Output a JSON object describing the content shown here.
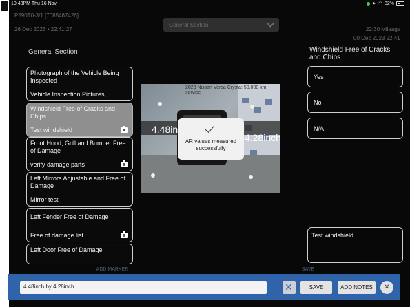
{
  "status_bar": {
    "time": "10:43PM",
    "date": "Thu 16 Nov",
    "battery": "32%"
  },
  "header": {
    "line1": "P590T0-3/1 [7085467426]",
    "line2": "26 Dec 2023 • 22:41:27",
    "section_dropdown": "General Section",
    "right_line1": "22:30 Mileage",
    "right_line2": "00 Dec 2023 22:41"
  },
  "checklist": {
    "title": "General Section",
    "items": [
      {
        "title": "Photograph of the Vehicle Being Inspected",
        "note": "Vehicle Inspection Pictures,"
      },
      {
        "title": "Windshield Free of Cracks and Chips",
        "note": "Test windshield"
      },
      {
        "title": "Front Hood, Grill and Bumper Free of Damage",
        "note": "verify damage parts"
      },
      {
        "title": "Left Mirrors Adjustable and Free of Damage",
        "note": "Mirror test"
      },
      {
        "title": "Left Fender Free of Damage",
        "note": "Free of damage list"
      },
      {
        "title": "Left Door Free of Damage",
        "note": ""
      }
    ]
  },
  "photo": {
    "caption": "2023 Nissan Versa Crysta: 50,000 km service",
    "measure_left": "4.48inch",
    "measure_right": "4.28inch"
  },
  "toast": {
    "message": "AR values measured successfully"
  },
  "question": {
    "title": "Windshield Free of Cracks and Chips",
    "options": [
      "Yes",
      "No",
      "N/A"
    ],
    "notes": "Test windshield"
  },
  "dim_buttons": {
    "add_marker": "ADD MARKER",
    "save": "SAVE"
  },
  "toolbar": {
    "measurement_value": "4.48inch by 4.28inch",
    "save_label": "SAVE",
    "add_notes_label": "ADD NOTES",
    "close_glyph": "✕"
  }
}
